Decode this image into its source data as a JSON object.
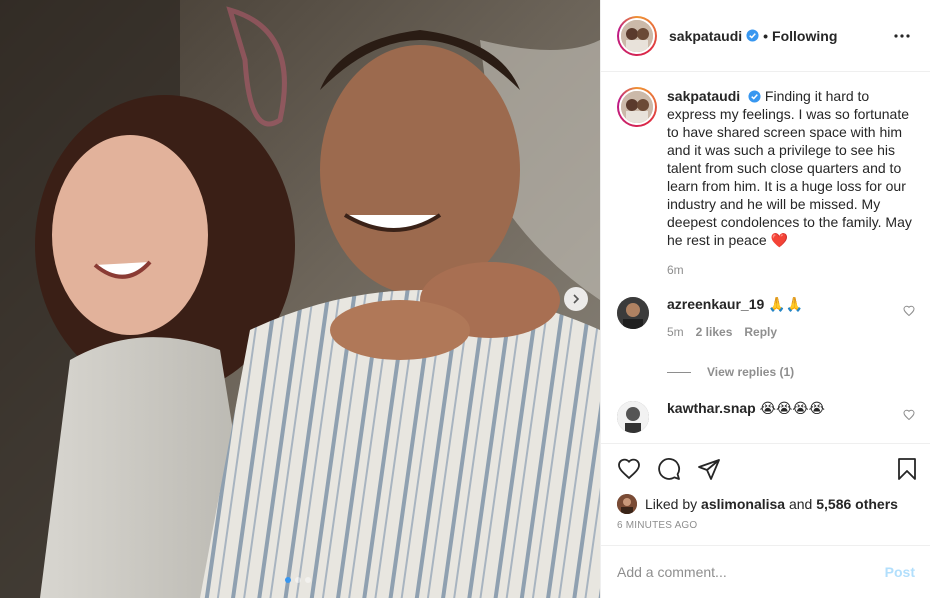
{
  "post": {
    "username": "sakpataudi",
    "following_label": "Following",
    "separator": "•",
    "more_icon": "more-horizontal-icon",
    "verified_icon": "verified-badge-icon"
  },
  "caption": {
    "username": "sakpataudi",
    "text": "Finding it hard to express my feelings. I was so fortunate to have shared screen space with him and it was such a privilege to see his talent from such close quarters and to learn from him. It is a huge loss for our industry and he will be missed. My deepest condolences to the family. May he rest in peace",
    "emoji": "❤️",
    "time": "6m"
  },
  "comments": [
    {
      "username": "azreenkaur_19",
      "text": "🙏🙏",
      "time": "5m",
      "likes": "2 likes",
      "reply_label": "Reply",
      "view_replies": "View replies (1)"
    },
    {
      "username": "kawthar.snap",
      "text": "😭😭😭😭"
    }
  ],
  "actions": {
    "like_icon": "heart-icon",
    "comment_icon": "comment-icon",
    "share_icon": "share-icon",
    "save_icon": "bookmark-icon"
  },
  "likes": {
    "prefix": "Liked by",
    "user": "aslimonalisa",
    "and": "and",
    "others": "5,586 others"
  },
  "timestamp": "6 MINUTES AGO",
  "add_comment": {
    "placeholder": "Add a comment...",
    "post_label": "Post"
  },
  "carousel": {
    "count": 3,
    "active_index": 0,
    "next_icon": "chevron-right-icon"
  },
  "colors": {
    "accent": "#3897f0",
    "post_disabled": "#b2dffc",
    "muted": "#8e8e8e",
    "heart": "#ed4956"
  }
}
